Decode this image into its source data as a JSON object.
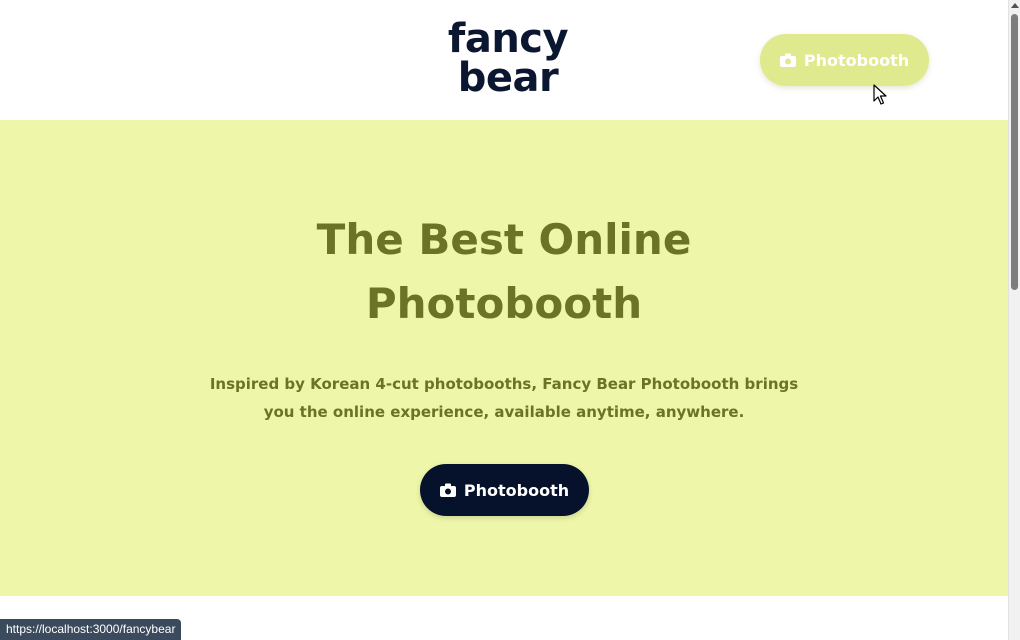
{
  "header": {
    "logo_line1": "fancy",
    "logo_line2": "bear",
    "photobooth_button_label": "Photobooth"
  },
  "hero": {
    "title_line1": "The Best Online",
    "title_line2": "Photobooth",
    "description_line1": "Inspired by Korean 4-cut photobooths, Fancy Bear Photobooth brings",
    "description_line2": "you the online experience, available anytime, anywhere.",
    "cta_button_label": "Photobooth"
  },
  "status_bar": {
    "url": "https://localhost:3000/fancybear"
  },
  "icons": {
    "button_icon": "camera-icon",
    "pointer": "mouse-cursor-icon"
  },
  "colors": {
    "hero_background": "#eef7a9",
    "hero_text": "#6a7326",
    "logo_text": "#0b1630",
    "header_button_bg": "#dfe98e",
    "cta_button_bg": "#06122b"
  }
}
